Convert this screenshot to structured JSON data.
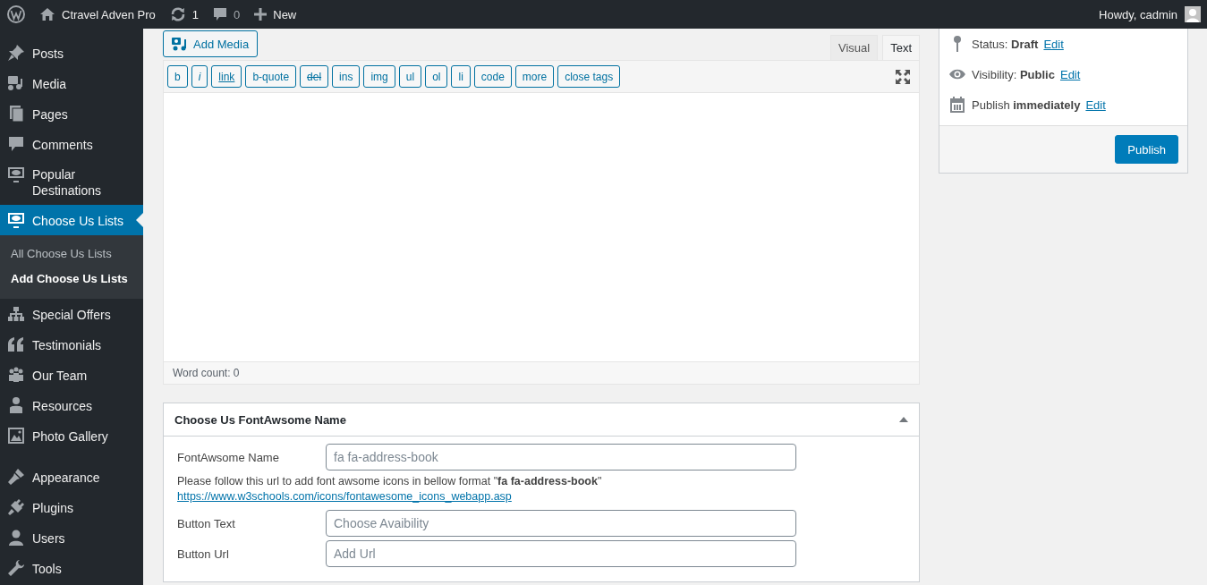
{
  "admin_bar": {
    "site_name": "Ctravel Adven Pro",
    "updates": "1",
    "comments": "0",
    "new_label": "New",
    "greeting": "Howdy, cadmin"
  },
  "sidebar": {
    "groups": [
      {
        "items": [
          {
            "label": "Posts",
            "kind": "pin",
            "selected": false
          },
          {
            "label": "Media",
            "kind": "media",
            "selected": false
          },
          {
            "label": "Pages",
            "kind": "pages",
            "selected": false
          },
          {
            "label": "Comments",
            "kind": "comment",
            "selected": false
          },
          {
            "label": "Popular Destinations",
            "kind": "monitor",
            "selected": false
          },
          {
            "label": "Choose Us Lists",
            "kind": "monitor",
            "selected": true,
            "submenu": [
              {
                "label": "All Choose Us Lists",
                "selected": false
              },
              {
                "label": "Add Choose Us Lists",
                "selected": true
              }
            ]
          },
          {
            "label": "Special Offers",
            "kind": "sitemap",
            "selected": false
          },
          {
            "label": "Testimonials",
            "kind": "quote",
            "selected": false
          },
          {
            "label": "Our Team",
            "kind": "team",
            "selected": false
          },
          {
            "label": "Resources",
            "kind": "person",
            "selected": false
          },
          {
            "label": "Photo Gallery",
            "kind": "image",
            "selected": false
          }
        ]
      },
      {
        "items": [
          {
            "label": "Appearance",
            "kind": "brush",
            "selected": false
          },
          {
            "label": "Plugins",
            "kind": "plug",
            "selected": false
          },
          {
            "label": "Users",
            "kind": "user",
            "selected": false
          },
          {
            "label": "Tools",
            "kind": "wrench",
            "selected": false
          }
        ]
      }
    ]
  },
  "editor": {
    "add_media": "Add Media",
    "tabs": [
      {
        "label": "Visual",
        "selected": false
      },
      {
        "label": "Text",
        "selected": true
      }
    ],
    "quicktags": [
      {
        "label": "b",
        "kind": "plain"
      },
      {
        "label": "i",
        "kind": "italic"
      },
      {
        "label": "link",
        "kind": "link"
      },
      {
        "label": "b-quote",
        "kind": "plain"
      },
      {
        "label": "del",
        "kind": "strike"
      },
      {
        "label": "ins",
        "kind": "plain"
      },
      {
        "label": "img",
        "kind": "plain"
      },
      {
        "label": "ul",
        "kind": "plain"
      },
      {
        "label": "ol",
        "kind": "plain"
      },
      {
        "label": "li",
        "kind": "plain"
      },
      {
        "label": "code",
        "kind": "plain"
      },
      {
        "label": "more",
        "kind": "plain"
      },
      {
        "label": "close tags",
        "kind": "plain"
      }
    ],
    "word_count": "Word count: 0"
  },
  "metabox": {
    "title": "Choose Us FontAwsome Name",
    "expanded": true,
    "rows": [
      {
        "kind": "field",
        "label": "FontAwsome Name",
        "placeholder": "fa fa-address-book"
      },
      {
        "kind": "note",
        "text": "Please follow this url to add font awsome icons in bellow format \"**fa fa-address-book**\"",
        "link": "https://www.w3schools.com/icons/fontawesome_icons_webapp.asp"
      },
      {
        "kind": "field",
        "label": "Button Text",
        "placeholder": "Choose Avaibility"
      },
      {
        "kind": "field",
        "label": "Button Url",
        "placeholder": "Add Url"
      }
    ]
  },
  "publish": {
    "rows": [
      {
        "kind": "status",
        "text": "Status: **Draft**",
        "link": "Edit"
      },
      {
        "kind": "visibility",
        "text": "Visibility: **Public**",
        "link": "Edit"
      },
      {
        "kind": "schedule",
        "text": "Publish **immediately**",
        "link": "Edit"
      }
    ],
    "button": "Publish"
  }
}
